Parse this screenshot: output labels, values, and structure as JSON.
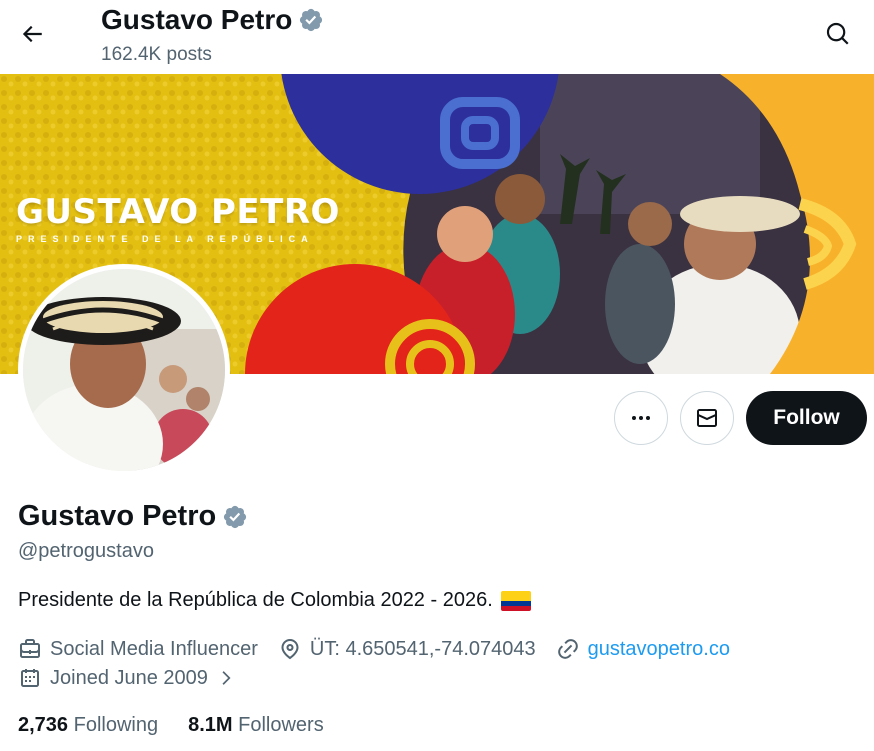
{
  "header": {
    "title": "Gustavo Petro",
    "posts": "162.4K posts",
    "back_icon": "arrow-left-icon",
    "search_icon": "search-icon"
  },
  "banner": {
    "name": "GUSTAVO PETRO",
    "subtitle": "PRESIDENTE DE LA REPÚBLICA"
  },
  "actions": {
    "more_icon": "more-icon",
    "message_icon": "mail-icon",
    "follow_label": "Follow"
  },
  "profile": {
    "name": "Gustavo Petro",
    "handle": "@petrogustavo",
    "bio": "Presidente de la República de Colombia 2022 - 2026.",
    "verified": true,
    "category": "Social Media Influencer",
    "location": "ÜT: 4.650541,-74.074043",
    "website": "gustavopetro.co",
    "joined": "Joined June 2009"
  },
  "stats": {
    "following_count": "2,736",
    "following_label": "Following",
    "followers_count": "8.1M",
    "followers_label": "Followers"
  },
  "colors": {
    "verified_badge": "#829aab",
    "follow_bg": "#0f1419",
    "link": "#1d9bf0",
    "muted": "#536471",
    "banner_yellow": "#e7c11a",
    "banner_blue": "#2d2f9c",
    "banner_red": "#e3241b",
    "banner_orange": "#f8b12b"
  }
}
